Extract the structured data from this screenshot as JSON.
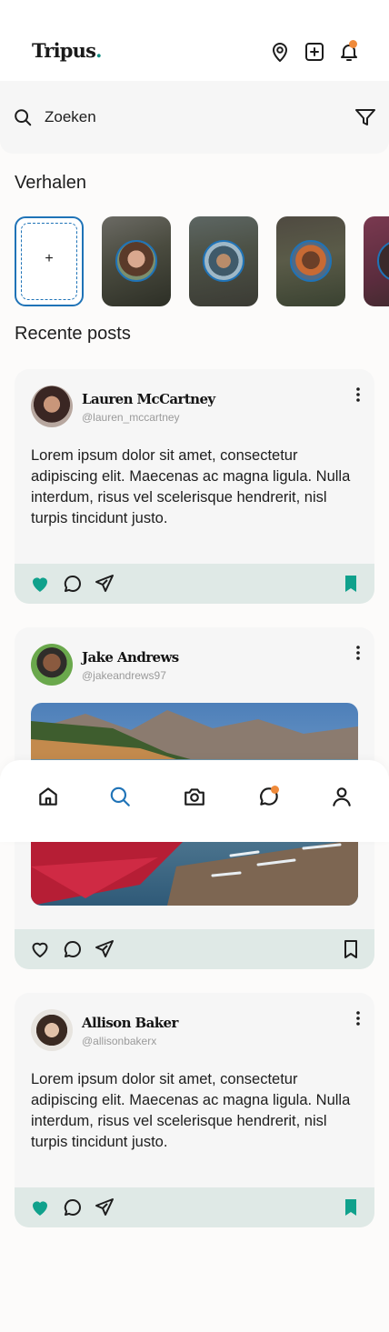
{
  "app": {
    "logo_text": "Tripus",
    "logo_dot": "."
  },
  "header": {
    "icons": [
      "map-pin-icon",
      "add-square-icon",
      "bell-icon"
    ],
    "notification_dot_color": "#ef8a3a"
  },
  "search": {
    "placeholder": "Zoeken"
  },
  "stories": {
    "title": "Verhalen",
    "add_label": "+",
    "items": [
      {
        "name": "story-1",
        "avatar": "avatar-woman-dark-hair"
      },
      {
        "name": "story-2",
        "avatar": "avatar-man-cap"
      },
      {
        "name": "story-3",
        "avatar": "avatar-man-smiling"
      },
      {
        "name": "story-4",
        "avatar": "avatar-partial"
      }
    ]
  },
  "recent": {
    "title": "Recente posts"
  },
  "posts": [
    {
      "author": "Lauren McCartney",
      "handle": "@lauren_mccartney",
      "text": "Lorem ipsum dolor sit amet, consectetur adipiscing elit. Maecenas ac magna ligula. Nulla interdum, risus vel scelerisque hendrerit, nisl turpis tincidunt justo.",
      "liked": true,
      "saved": true
    },
    {
      "author": "Jake Andrews",
      "handle": "@jakeandrews97",
      "image": "mountain-lake-with-red-kayaks",
      "liked": false,
      "saved": false
    },
    {
      "author": "Allison Baker",
      "handle": "@allisonbakerx",
      "text": "Lorem ipsum dolor sit amet, consectetur adipiscing elit. Maecenas ac magna ligula. Nulla interdum, risus vel scelerisque hendrerit, nisl turpis tincidunt justo.",
      "liked": true,
      "saved": true
    }
  ],
  "tabbar": {
    "items": [
      "home-icon",
      "search-icon",
      "camera-icon",
      "chat-icon",
      "profile-icon"
    ],
    "active": "search-icon"
  },
  "colors": {
    "accent": "#1f73b7",
    "liked": "#10a18c",
    "action_bar": "#dfe9e6",
    "dot": "#ef8a3a"
  }
}
